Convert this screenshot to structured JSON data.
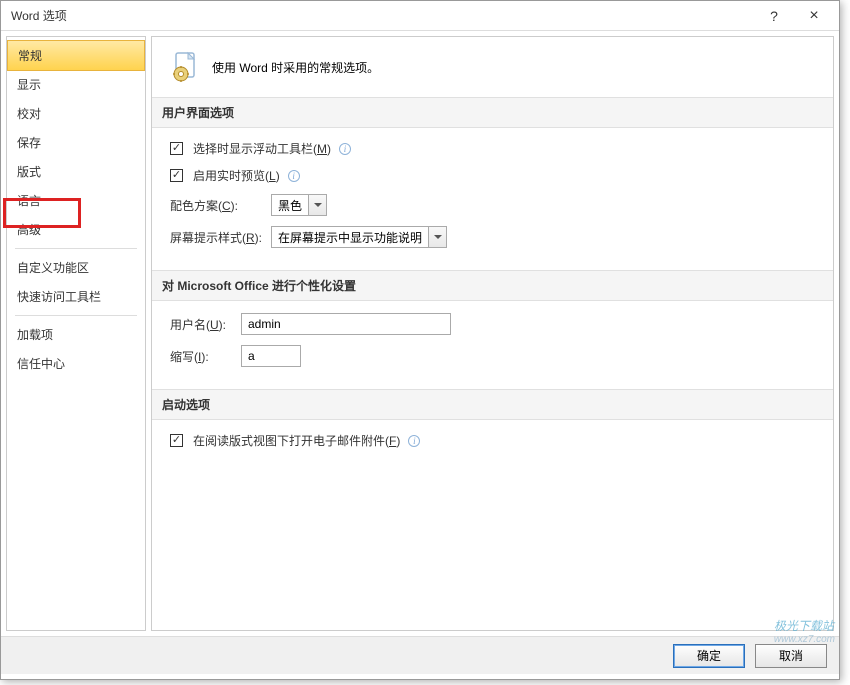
{
  "window": {
    "title": "Word 选项",
    "help_glyph": "?",
    "close_glyph": "×"
  },
  "sidebar": {
    "items": [
      {
        "label": "常规",
        "selected": true
      },
      {
        "label": "显示"
      },
      {
        "label": "校对"
      },
      {
        "label": "保存"
      },
      {
        "label": "版式"
      },
      {
        "label": "语言"
      },
      {
        "label": "高级",
        "highlighted": true
      },
      {
        "label": "自定义功能区"
      },
      {
        "label": "快速访问工具栏"
      },
      {
        "label": "加载项"
      },
      {
        "label": "信任中心"
      }
    ]
  },
  "intro": {
    "text": "使用 Word 时采用的常规选项。"
  },
  "sections": {
    "ui": {
      "header": "用户界面选项",
      "mini_toolbar": {
        "label_pre": "选择时显示浮动工具栏(",
        "key": "M",
        "label_post": ")",
        "checked": true
      },
      "live_preview": {
        "label_pre": "启用实时预览(",
        "key": "L",
        "label_post": ")",
        "checked": true
      },
      "color_scheme": {
        "label_pre": "配色方案(",
        "key": "C",
        "label_post": "):",
        "value": "黑色"
      },
      "screentip": {
        "label_pre": "屏幕提示样式(",
        "key": "R",
        "label_post": "):",
        "value": "在屏幕提示中显示功能说明"
      }
    },
    "personalize": {
      "header": "对 Microsoft Office 进行个性化设置",
      "username": {
        "label_pre": "用户名(",
        "key": "U",
        "label_post": "):",
        "value": "admin"
      },
      "initials": {
        "label_pre": "缩写(",
        "key": "I",
        "label_post": "):",
        "value": "a"
      }
    },
    "startup": {
      "header": "启动选项",
      "open_attachments": {
        "label_pre": "在阅读版式视图下打开电子邮件附件(",
        "key": "F",
        "label_post": ")",
        "checked": true
      }
    }
  },
  "footer": {
    "ok": "确定",
    "cancel": "取消"
  },
  "info_glyph": "i",
  "watermark": {
    "line1": "极光下载站",
    "line2": "www.xz7.com"
  }
}
